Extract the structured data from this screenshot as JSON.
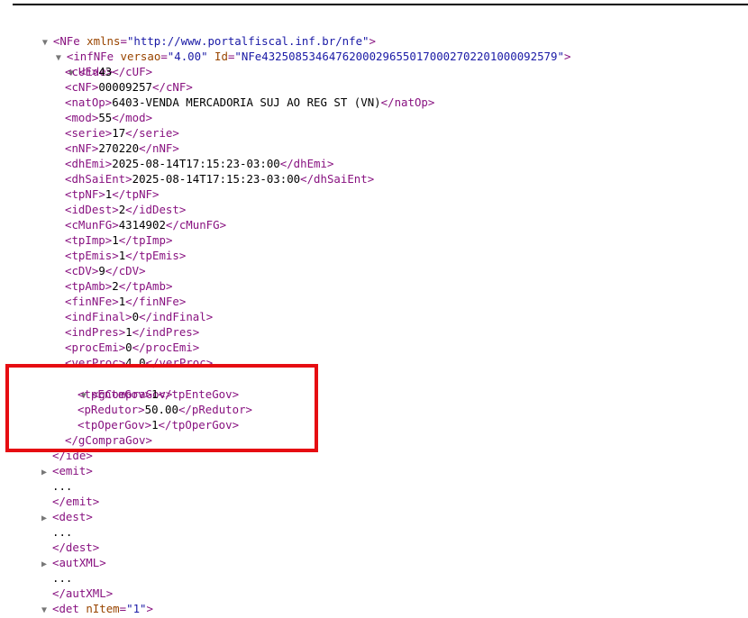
{
  "colors": {
    "tag": "#881280",
    "attr_name": "#994500",
    "attr_value": "#1a1aa6",
    "highlight": "#e60d12"
  },
  "icons": {
    "expanded": "triangle-down-icon",
    "collapsed": "triangle-right-icon"
  },
  "root": {
    "name": "NFe",
    "attr": "xmlns",
    "value": "\"http://www.portalfiscal.inf.br/nfe\""
  },
  "infNFe": {
    "name": "infNFe",
    "attrs": [
      {
        "name": "versao",
        "value": "\"4.00\""
      },
      {
        "name": "Id",
        "value": "\"NFe43250853464762000296550170002702201000092579\""
      }
    ]
  },
  "ide": {
    "name": "ide",
    "fields": [
      {
        "tag": "cUF",
        "value": "43"
      },
      {
        "tag": "cNF",
        "value": "00009257"
      },
      {
        "tag": "natOp",
        "value": "6403-VENDA MERCADORIA SUJ AO REG ST (VN)"
      },
      {
        "tag": "mod",
        "value": "55"
      },
      {
        "tag": "serie",
        "value": "17"
      },
      {
        "tag": "nNF",
        "value": "270220"
      },
      {
        "tag": "dhEmi",
        "value": "2025-08-14T17:15:23-03:00"
      },
      {
        "tag": "dhSaiEnt",
        "value": "2025-08-14T17:15:23-03:00"
      },
      {
        "tag": "tpNF",
        "value": "1"
      },
      {
        "tag": "idDest",
        "value": "2"
      },
      {
        "tag": "cMunFG",
        "value": "4314902"
      },
      {
        "tag": "tpImp",
        "value": "1"
      },
      {
        "tag": "tpEmis",
        "value": "1"
      },
      {
        "tag": "cDV",
        "value": "9"
      },
      {
        "tag": "tpAmb",
        "value": "2"
      },
      {
        "tag": "finNFe",
        "value": "1"
      },
      {
        "tag": "indFinal",
        "value": "0"
      },
      {
        "tag": "indPres",
        "value": "1"
      },
      {
        "tag": "procEmi",
        "value": "0"
      },
      {
        "tag": "verProc",
        "value": "4.0"
      }
    ]
  },
  "gCompraGov": {
    "name": "gCompraGov",
    "fields": [
      {
        "tag": "tpEnteGov",
        "value": "1"
      },
      {
        "tag": "pRedutor",
        "value": "50.00"
      },
      {
        "tag": "tpOperGov",
        "value": "1"
      }
    ]
  },
  "collapsed": [
    {
      "name": "emit",
      "ellipsis": "..."
    },
    {
      "name": "dest",
      "ellipsis": "..."
    },
    {
      "name": "autXML",
      "ellipsis": "..."
    }
  ],
  "det": {
    "name": "det",
    "attr": "nItem",
    "value": "\"1\""
  }
}
